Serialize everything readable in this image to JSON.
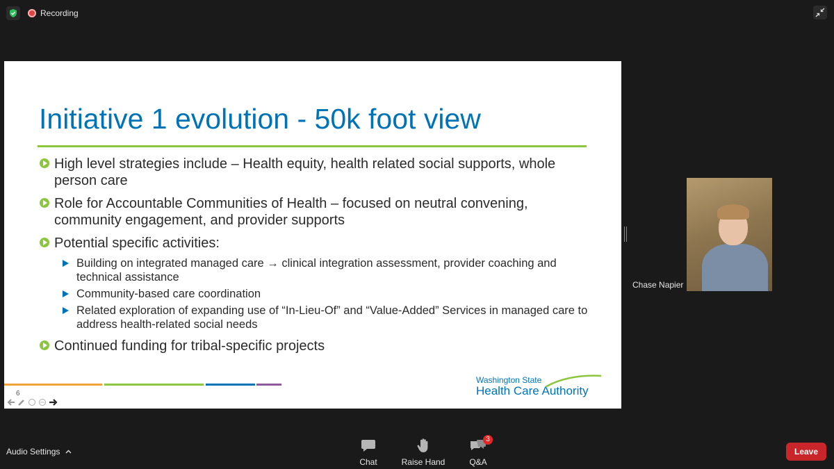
{
  "top_bar": {
    "recording_label": "Recording"
  },
  "slide": {
    "title": "Initiative 1 evolution - 50k foot view",
    "bullets": [
      {
        "text": "High level strategies include – Health equity, health related social supports, whole person care"
      },
      {
        "text": "Role for Accountable Communities of Health – focused on neutral convening, community engagement, and provider supports"
      },
      {
        "text": "Potential specific activities:"
      },
      {
        "text": "Continued funding for tribal-specific projects"
      }
    ],
    "sub_bullets": [
      "Building on integrated managed care → clinical integration assessment, provider coaching and technical assistance",
      "Community-based care coordination",
      "Related exploration of expanding use of “In-Lieu-Of” and “Value-Added” Services in managed care to address health-related social needs"
    ],
    "slide_number": "6",
    "logo_line1": "Washington State",
    "logo_line2": "Health Care Authority",
    "footer_bar_colors": [
      "#f0a23b",
      "#8cc63f",
      "#0073b7",
      "#8e5a9b"
    ],
    "title_color": "#0073b7",
    "accent_color": "#8cc63f"
  },
  "participant": {
    "name": "Chase Napier"
  },
  "toolbar": {
    "audio_settings_label": "Audio Settings",
    "chat_label": "Chat",
    "raise_hand_label": "Raise Hand",
    "qa_label": "Q&A",
    "qa_badge": "3",
    "leave_label": "Leave"
  }
}
